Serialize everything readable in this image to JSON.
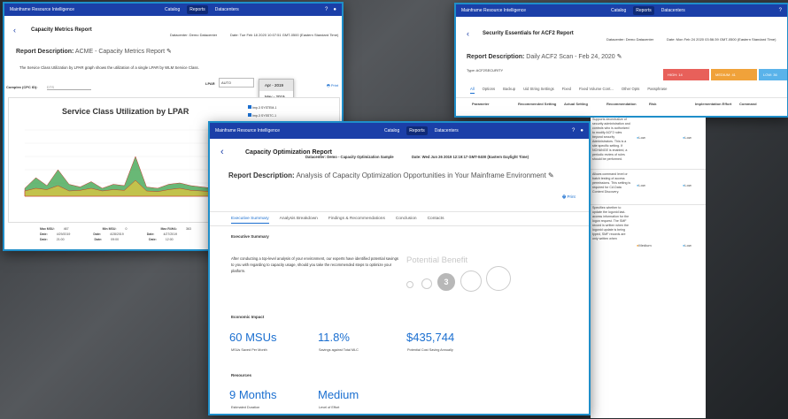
{
  "brand": "Mainframe Resource Intelligence",
  "nav": [
    "Catalog",
    "Reports",
    "Datacenters"
  ],
  "w1": {
    "title": "Capacity Metrics Report",
    "datacenter": "Datacenter: Demo Datacenter",
    "date": "Date: Tue Feb 18 2020 10:07:51 GMT-0500 (Eastern Standard Time)",
    "desc_label": "Report Description:",
    "desc_value": "ACME - Capacity Metrics Report",
    "blurb": "The Service Class Utilization by LPAR graph shows the utilization of a single LPAR by WLM Service Class.",
    "complex_label": "Complex (CPC ID):",
    "complex_value": "DTS",
    "lpar_label": "LPAR",
    "lpar_value": "AUTO",
    "month_selected": "Apr - 2019",
    "month_options": [
      "Apr - 2019",
      "May - 2019"
    ],
    "print": "Print",
    "chart_title": "Service Class Utilization by LPAR",
    "legend": [
      "Imp-3 SYSTEM-1",
      "Imp-3 SYSSTC-1"
    ],
    "stats": [
      {
        "k": "Max MSU:",
        "v": "467",
        "k2": "Min MSU:",
        "v2": "0",
        "k3": "Max R4HA:",
        "v3": "363"
      },
      {
        "k": "Date:",
        "v": "4/29/2019",
        "k2": "Date:",
        "v2": "4/28/2019",
        "k3": "Date:",
        "v3": "4/27/2019"
      },
      {
        "k": "Date:",
        "v": "21:00",
        "k2": "Date:",
        "v2": "09:00",
        "k3": "Date:",
        "v3": "12:00"
      }
    ],
    "chart_data": {
      "type": "area",
      "title": "Service Class Utilization by LPAR",
      "ylim": [
        0,
        500
      ],
      "series": [
        {
          "name": "Imp-3 SYSTEM-1",
          "values": [
            60,
            140,
            80,
            200,
            90,
            70,
            110,
            60,
            90,
            80,
            300,
            70,
            60,
            90,
            100,
            80,
            70,
            60,
            90,
            80,
            70
          ]
        },
        {
          "name": "Imp-3 SYSSTC-1",
          "values": [
            40,
            60,
            50,
            80,
            40,
            45,
            60,
            40,
            50,
            45,
            120,
            40,
            35,
            50,
            60,
            45,
            40,
            35,
            50,
            45,
            40
          ]
        }
      ]
    }
  },
  "w2": {
    "title": "Security Essentials for ACF2 Report",
    "datacenter": "Datacenter: Demo Datacenter",
    "date": "Date: Mon Feb 24 2020 03:56:39 GMT-0500 (Eastern Standard Time)",
    "desc_label": "Report Description:",
    "desc_value": "Daily ACF2 Scan - Feb 24, 2020",
    "type": "Type: ACF2SECURITY",
    "risk_chips": [
      {
        "label": "HIGH: 14",
        "color": "#e8605a"
      },
      {
        "label": "MEDIUM: 41",
        "color": "#f0a23a"
      },
      {
        "label": "LOW: 36",
        "color": "#5ab3ea"
      }
    ],
    "tabs": [
      "All",
      "Options",
      "Backup",
      "Uid String Settings",
      "Fixed",
      "Fixed Volume Cont...",
      "Other Opts",
      "Passphrase"
    ],
    "columns": [
      "Parameter",
      "Recommended Setting",
      "Actual Setting",
      "Recommendation",
      "Risk",
      "Implementation Effort",
      "Command"
    ]
  },
  "rows_side": [
    {
      "text": "Supports decentralize of security administration and controls who is authorized to modify ACF2 rules beyond security Administrators. This is a site specific setting. If NCHANGE is enabled, a periodic review of rules should be performed.",
      "risk": "Low",
      "effort": "Low",
      "color": "#5ab3ea"
    },
    {
      "text": "Allows command level or batch testing of access permissions. This setting is required for CA Data Content Discovery.",
      "risk": "Low",
      "effort": "Low",
      "color": "#5ab3ea"
    },
    {
      "text": "Specifies whether to update the logonid last-access information for the logon request. The SMF record is written when the logonid update is being typed, SMF records are only written when",
      "risk": "Medium",
      "effort": "Low",
      "color": "#f0a23a"
    }
  ],
  "w3": {
    "title": "Capacity Optimization Report",
    "datacenter": "Datacenter: Demo - Capacity Optimization Sample",
    "date": "Date: Wed Jun 26 2019 12:19:17 GMT-0400 (Eastern Daylight Time)",
    "desc_label": "Report Description:",
    "desc_value": "Analysis of Capacity Optimization Opportunities in Your Mainframe Environment",
    "print": "Print",
    "tabs": [
      "Executive Summary",
      "Analysis Breakdown",
      "Findings & Recommendations",
      "Conclusion",
      "Contacts"
    ],
    "exec_title": "Executive Summary",
    "exec_text": "After conducting a top-level analysis of your environment, our experts have identified potential savings to you with regarding to capacity usage, should you take the recommended steps to optimize your platform.",
    "potential": "Potential Benefit",
    "benefit_level": "3",
    "econ_title": "Economic Impact",
    "metrics": [
      {
        "value": "60 MSUs",
        "caption": "MSUs Saved Per Month"
      },
      {
        "value": "11.8%",
        "caption": "Savings against Total MLC"
      },
      {
        "value": "$435,744",
        "caption": "Potential Cost Saving Annually"
      }
    ],
    "res_title": "Resources",
    "resources": [
      {
        "value": "9 Months",
        "caption": "Estimated Duration"
      },
      {
        "value": "Medium",
        "caption": "Level of Effort"
      }
    ]
  }
}
